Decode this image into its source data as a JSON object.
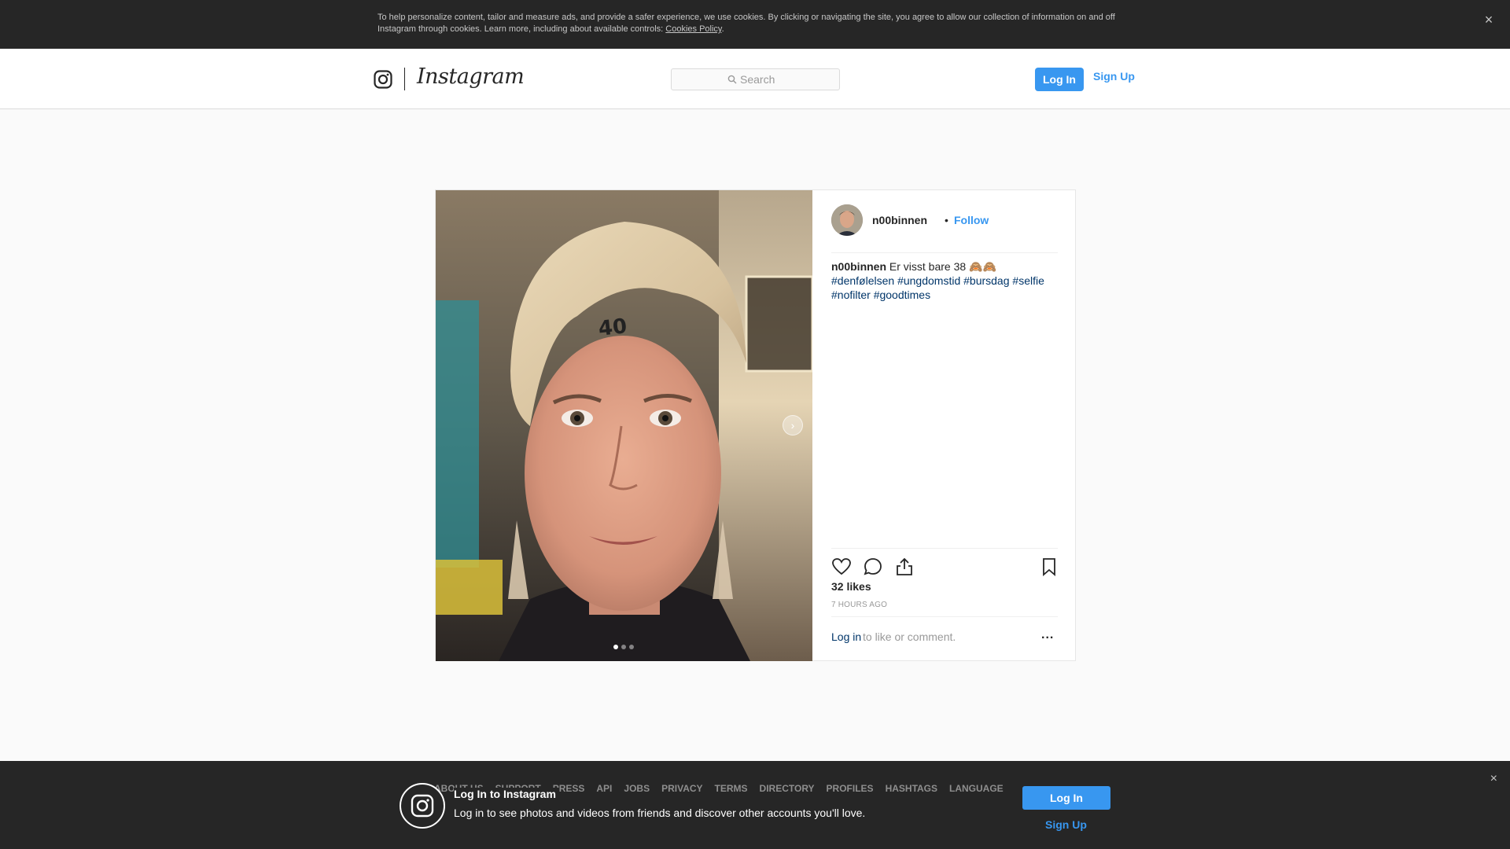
{
  "cookie_banner": {
    "text": "To help personalize content, tailor and measure ads, and provide a safer experience, we use cookies. By clicking or navigating the site, you agree to allow our collection of information on and off Instagram through cookies. Learn more, including about available controls: ",
    "link_label": "Cookies Policy",
    "trailing": ".",
    "close_icon": "close-icon"
  },
  "header": {
    "logo_text": "Instagram",
    "logo_icon": "instagram-camera-icon",
    "search_placeholder": "Search",
    "login_label": "Log In",
    "signup_label": "Sign Up"
  },
  "post": {
    "username": "n00binnen",
    "bullet": "•",
    "follow_label": "Follow",
    "caption_user": "n00binnen",
    "caption_text": "Er visst bare 38 🙈🙈",
    "hashtags": [
      "#denfølelsen",
      "#ungdomstid",
      "#bursdag",
      "#selfie",
      "#nofilter",
      "#goodtimes"
    ],
    "forehead_number": "40",
    "carousel": {
      "count": 3,
      "active_index": 0
    },
    "likes": "32 likes",
    "time_ago": "7 HOURS AGO",
    "comment_login_label": "Log in",
    "comment_suffix": "to like or comment.",
    "more_label": "..."
  },
  "footer": {
    "links": [
      "ABOUT US",
      "SUPPORT",
      "PRESS",
      "API",
      "JOBS",
      "PRIVACY",
      "TERMS",
      "DIRECTORY",
      "PROFILES",
      "HASHTAGS",
      "LANGUAGE"
    ]
  },
  "login_prompt": {
    "title": "Log In to Instagram",
    "description": "Log in to see photos and videos from friends and discover other accounts you'll love.",
    "login_label": "Log In",
    "signup_label": "Sign Up",
    "close_icon": "close-icon"
  },
  "colors": {
    "accent": "#3897f0",
    "hashtag": "#003569",
    "dark_bar": "#262626"
  }
}
